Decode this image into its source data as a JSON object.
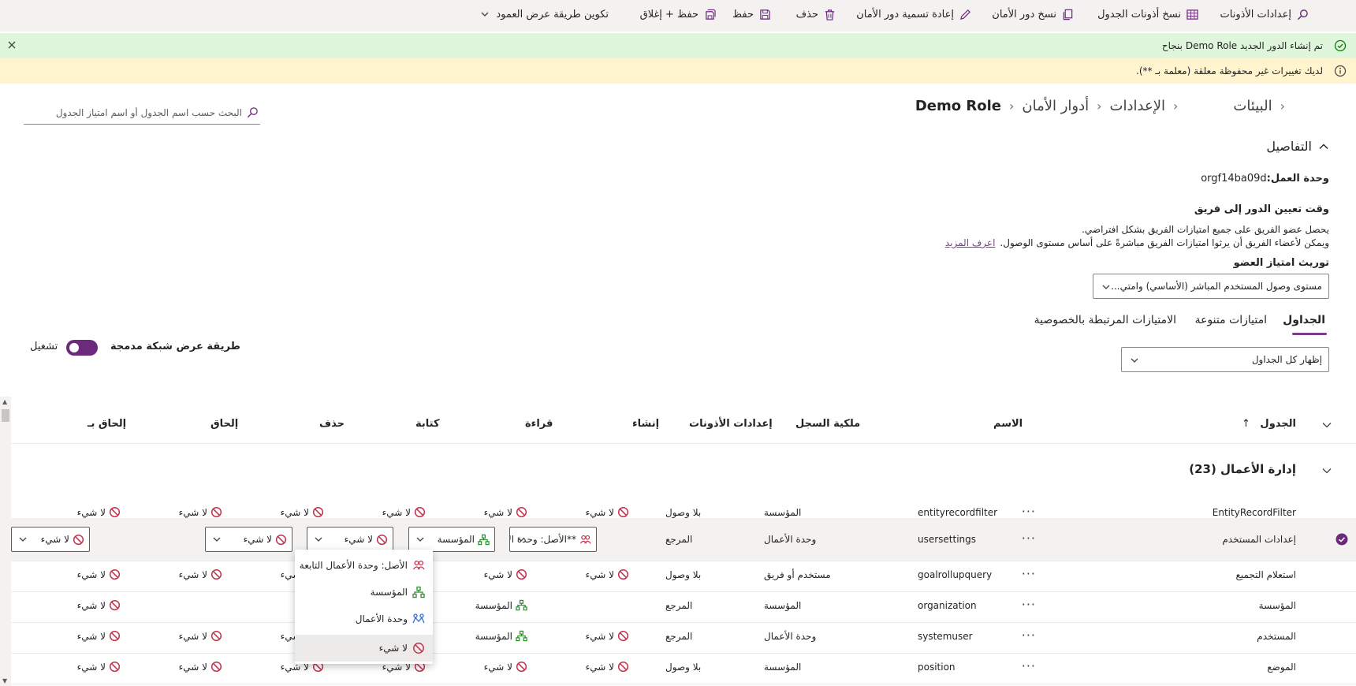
{
  "commandbar": {
    "items": [
      {
        "label": "إعدادات الأذونات",
        "icon": "search-settings-icon"
      },
      {
        "label": "نسخ أذونات الجدول",
        "icon": "table-icon"
      },
      {
        "label": "نسخ دور الأمان",
        "icon": "copy-icon"
      },
      {
        "label": "إعادة تسمية دور الأمان",
        "icon": "pencil-icon"
      },
      {
        "label": "حذف",
        "icon": "trash-icon"
      },
      {
        "label": "حفظ",
        "icon": "save-icon"
      },
      {
        "label": "حفظ + إغلاق",
        "icon": "save-close-icon"
      },
      {
        "label": "تكوين طريقة عرض العمود",
        "icon": "chevron-down-icon"
      }
    ]
  },
  "banners": {
    "success": "تم إنشاء الدور الجديد Demo Role بنجاح",
    "warning": "لديك تغييرات غير محفوظة معلقة (معلمة بـ **)."
  },
  "breadcrumb": [
    "البيئات",
    "الإعدادات",
    "أدوار الأمان",
    "Demo Role"
  ],
  "search": {
    "placeholder": "البحث حسب اسم الجدول أو اسم امتياز الجدول"
  },
  "details": {
    "heading": "التفاصيل",
    "business_unit_label": "وحدة العمل:",
    "business_unit_value": "orgf14ba09d",
    "team_assign_heading": "وقت تعيين الدور إلى فريق",
    "team_line1": "يحصل عضو الفريق على جميع امتيازات الفريق بشكل افتراضي.",
    "team_line2": "ويمكن لأعضاء الفريق أن يرثوا امتيازات الفريق مباشرةً على أساس مستوى الوصول.",
    "learn_more": "اعرف المزيد",
    "inheritance_label": "توريث امتياز العضو",
    "inheritance_value": "مستوى وصول المستخدم المباشر (الأساسي) وامتي..."
  },
  "tabs": [
    "الجداول",
    "امتيازات متنوعة",
    "الامتيازات المرتبطة بالخصوصية"
  ],
  "filter": {
    "value": "إظهار كل الجداول"
  },
  "compact": {
    "label": "طريقة عرض شبكة مدمجة",
    "state": "تشغيل",
    "on": true
  },
  "columns": {
    "table": "الجدول",
    "sort_arrow": "↑",
    "name": "الاسم",
    "ownership": "ملكية السجل",
    "perm": "إعدادات الأذونات",
    "create": "إنشاء",
    "read": "قراءة",
    "write": "كتابة",
    "delete": "حذف",
    "append": "إلحاق",
    "append_to": "إلحاق بـ"
  },
  "group": {
    "label": "إدارة الأعمال (23)"
  },
  "privilege_labels": {
    "none": "لا شيء",
    "org": "المؤسسة",
    "bu": "وحدة الأعمال",
    "parent": "الأصل: وحدة الأعمال التابعة",
    "parent_pending": "**الأصل: وحدة الأعمال التابعة"
  },
  "more_label": "···",
  "rows": [
    {
      "table": "EntityRecordFilter",
      "name": "entityrecordfilter",
      "ownership": "المؤسسة",
      "perm": "بلا وصول",
      "create": "none",
      "read": "none",
      "write": "none",
      "delete": "none",
      "append": "none",
      "append_to": "none"
    },
    {
      "table": "إعدادات المستخدم",
      "name": "usersettings",
      "ownership": "وحدة الأعمال",
      "perm": "المرجع",
      "create": "parent_pending",
      "read": "org",
      "write": "none",
      "delete": "none",
      "append": "",
      "append_to": "none",
      "selected": true
    },
    {
      "table": "استعلام التجميع",
      "name": "goalrollupquery",
      "ownership": "مستخدم أو فريق",
      "perm": "بلا وصول",
      "create": "none",
      "read": "none",
      "write": "",
      "delete": "none",
      "append": "none",
      "append_to": "none"
    },
    {
      "table": "المؤسسة",
      "name": "organization",
      "ownership": "المؤسسة",
      "perm": "المرجع",
      "create": "",
      "read": "org",
      "write": "",
      "delete": "",
      "append": "",
      "append_to": "none"
    },
    {
      "table": "المستخدم",
      "name": "systemuser",
      "ownership": "وحدة الأعمال",
      "perm": "المرجع",
      "create": "none",
      "read": "org",
      "write": "",
      "delete": "none",
      "append": "none",
      "append_to": "none"
    },
    {
      "table": "الموضع",
      "name": "position",
      "ownership": "المؤسسة",
      "perm": "بلا وصول",
      "create": "none",
      "read": "none",
      "write": "none",
      "delete": "none",
      "append": "none",
      "append_to": "none"
    }
  ],
  "menu": {
    "items": [
      {
        "label": "الأصل: وحدة الأعمال التابعة",
        "icon": "parent-bu-icon"
      },
      {
        "label": "المؤسسة",
        "icon": "organization-icon"
      },
      {
        "label": "وحدة الأعمال",
        "icon": "business-unit-icon"
      },
      {
        "label": "لا شيء",
        "icon": "none-icon",
        "hover": true
      }
    ]
  },
  "colors": {
    "accent": "#6b2a7c",
    "success_bg": "#dff6dd",
    "warning_bg": "#fff4ce",
    "none_red": "#c4314b",
    "org_green": "#2e8b2e",
    "bu_blue": "#2b6cd4"
  }
}
